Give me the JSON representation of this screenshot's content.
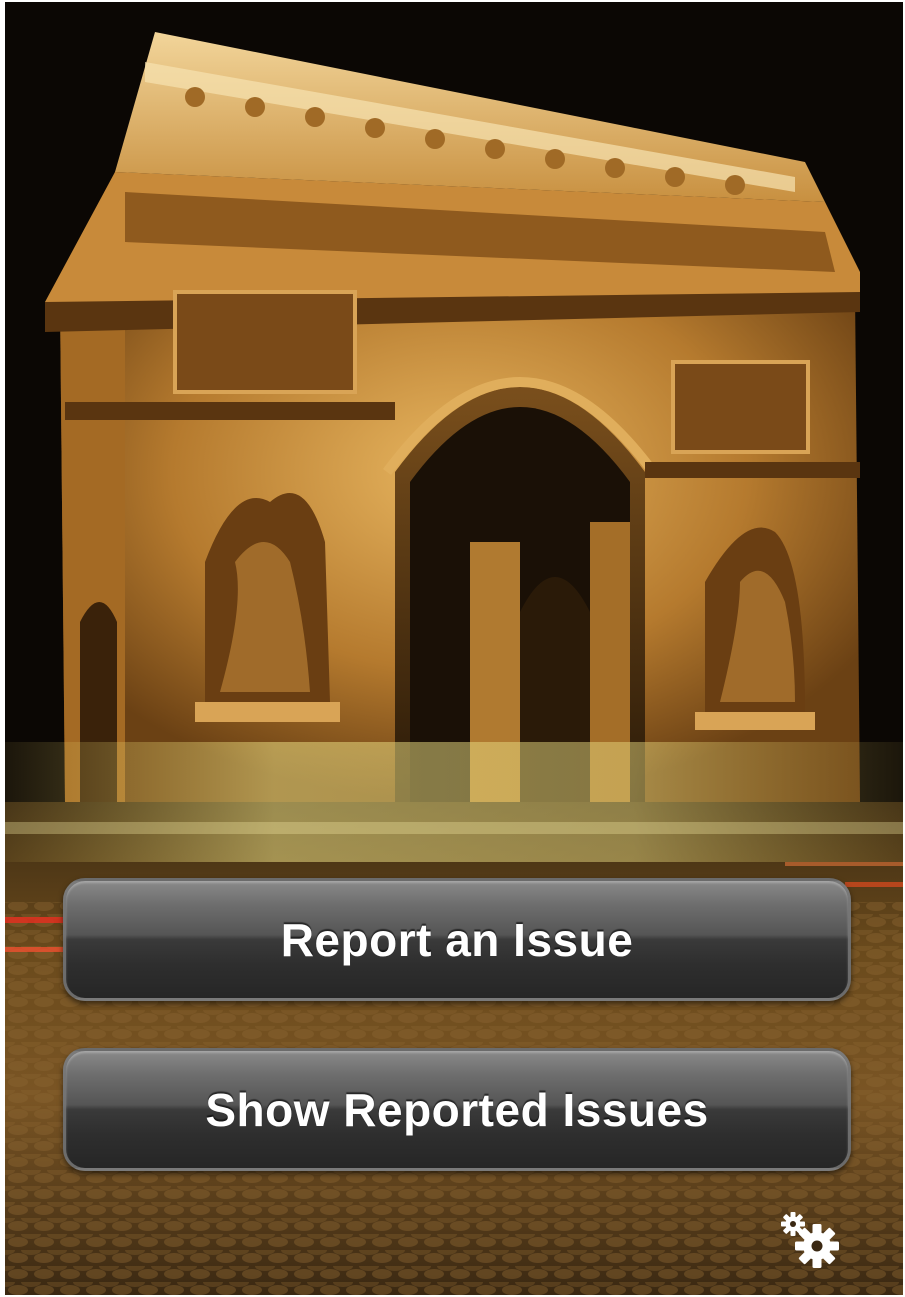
{
  "background": {
    "subject": "arc-de-triomphe-night-photo",
    "sky_color": "#0b0704",
    "stone_color": "#c9913c",
    "road_color": "#5a3d1a"
  },
  "buttons": {
    "report_label": "Report an Issue",
    "show_label": "Show Reported Issues"
  },
  "icons": {
    "settings": "gear-icon"
  },
  "colors": {
    "button_top": "#8a8a8a",
    "button_bottom": "#262626",
    "button_text": "#ffffff"
  }
}
